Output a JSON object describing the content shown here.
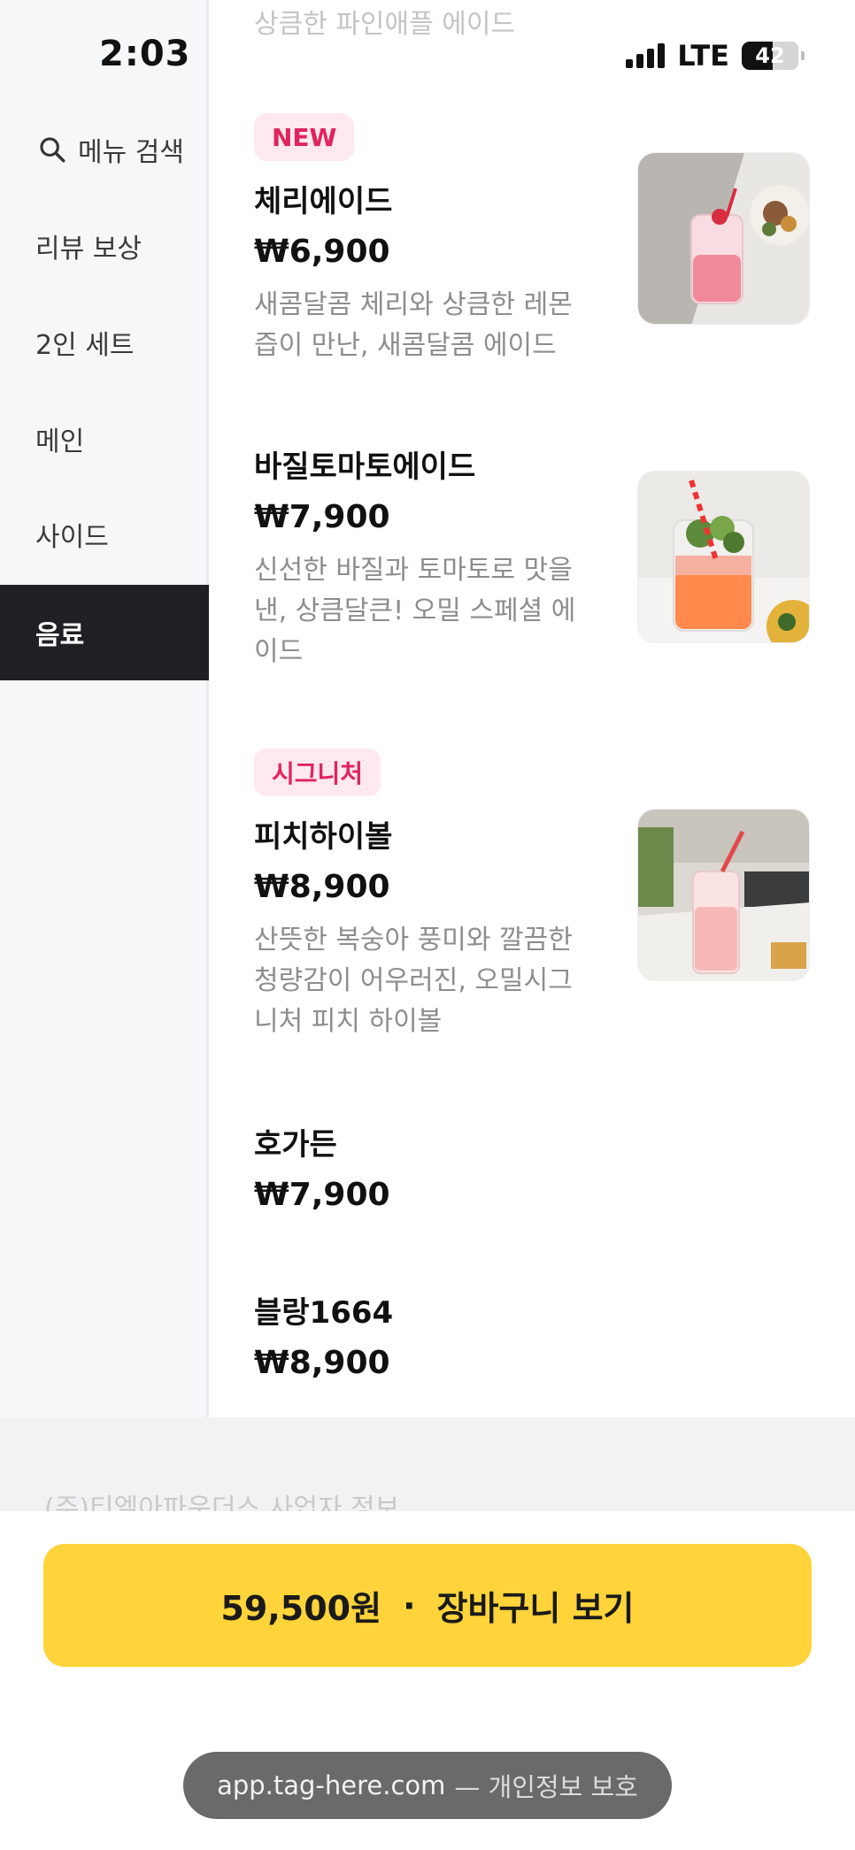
{
  "status_bar": {
    "time": "2:03",
    "network": "LTE",
    "battery": "42"
  },
  "sidebar": {
    "search_label": "메뉴 검색",
    "items": [
      {
        "label": "리뷰 보상"
      },
      {
        "label": "2인 세트"
      },
      {
        "label": "메인"
      },
      {
        "label": "사이드"
      },
      {
        "label": "음료",
        "active": true
      }
    ]
  },
  "menu": {
    "partial_top_desc": "상큼한 파인애플 에이드",
    "items": [
      {
        "badge": "NEW",
        "name": "체리에이드",
        "price": "₩6,900",
        "description": "새콤달콤 체리와 상큼한 레몬즙이 만난, 새콤달콤 에이드",
        "photo": "cherry-ade-photo"
      },
      {
        "name": "바질토마토에이드",
        "price": "₩7,900",
        "description": "신선한 바질과 토마토로 맛을 낸, 상큼달큰! 오밀 스페셜 에이드",
        "photo": "basil-tomato-ade-photo"
      },
      {
        "badge": "시그니처",
        "name": "피치하이볼",
        "price": "₩8,900",
        "description": "산뜻한 복숭아 풍미와 깔끔한 청량감이 어우러진, 오밀시그니처 피치 하이볼",
        "photo": "peach-highball-photo"
      },
      {
        "name": "호가든",
        "price": "₩7,900"
      },
      {
        "name": "블랑1664",
        "price": "₩8,900"
      }
    ]
  },
  "footer": {
    "company_info": "(주)티엘아파운더스 사업자 정보"
  },
  "cart": {
    "total": "59,500원",
    "separator": "·",
    "label": "장바구니 보기"
  },
  "browser": {
    "url": "app.tag-here.com",
    "privacy": "— 개인정보 보호"
  },
  "colors": {
    "accent": "#ffd43b",
    "badge_text": "#e0245e",
    "badge_bg": "#fde9ee",
    "sidebar_active": "#1f2024"
  }
}
